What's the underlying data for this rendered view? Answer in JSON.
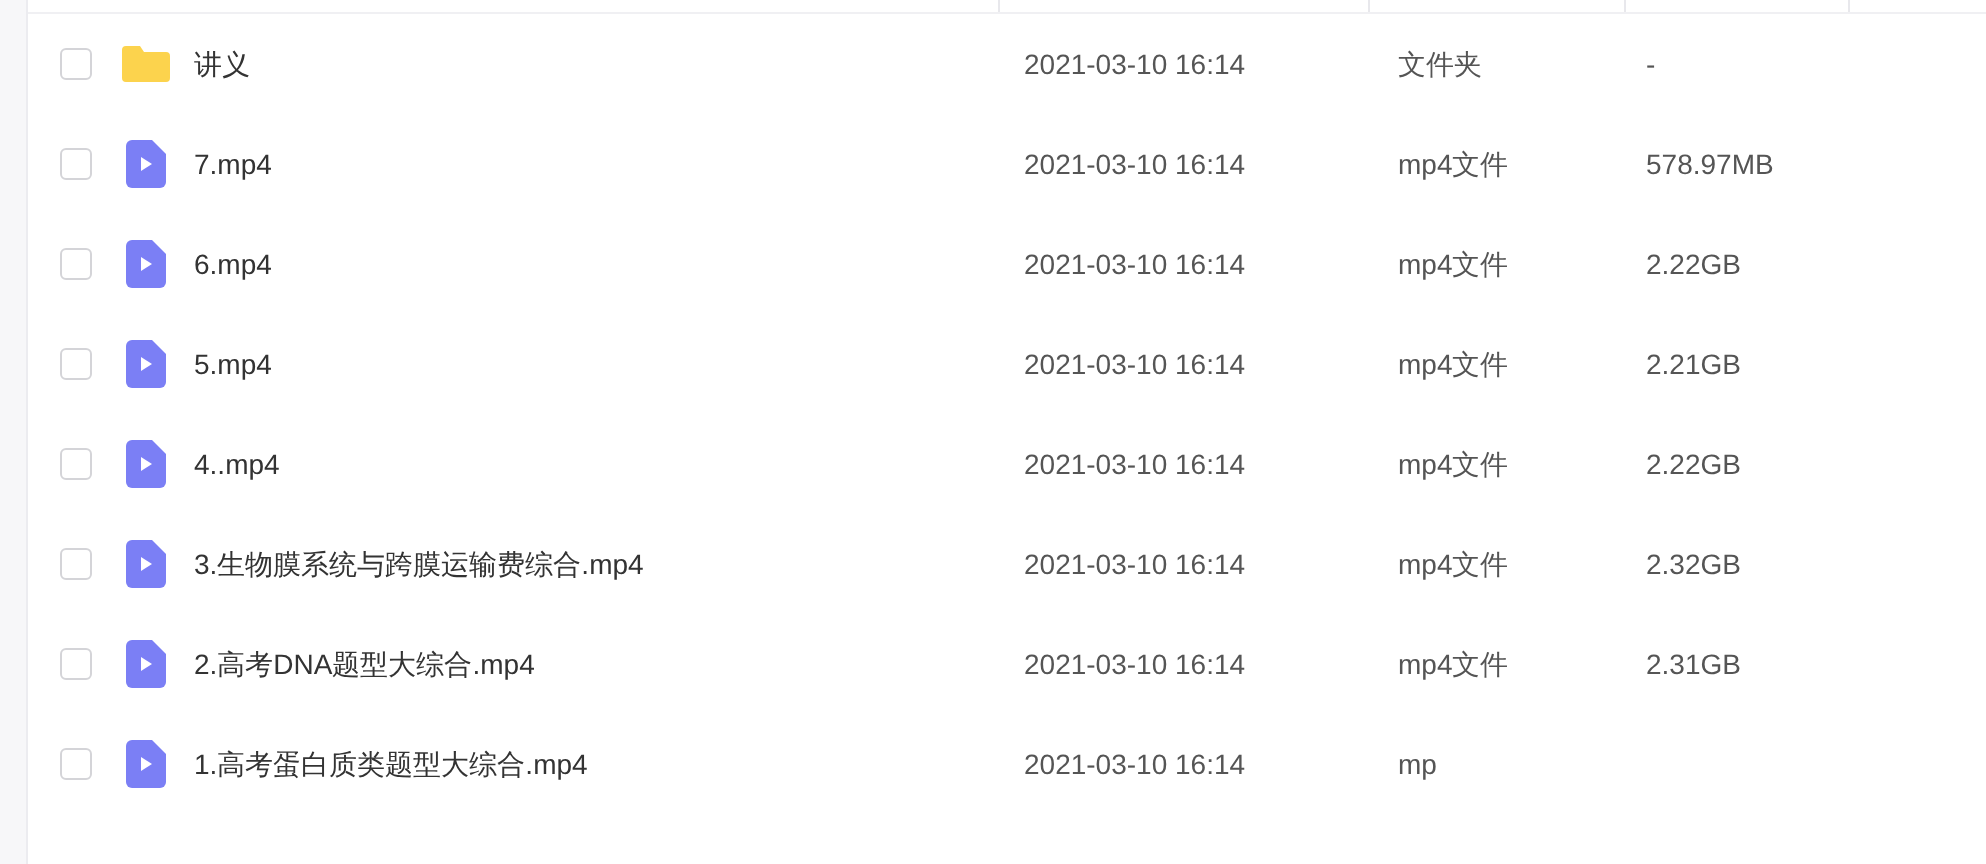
{
  "files": [
    {
      "kind": "folder",
      "name": "讲义",
      "modified": "2021-03-10 16:14",
      "type": "文件夹",
      "size": "-",
      "checked": false
    },
    {
      "kind": "video",
      "name": "7.mp4",
      "modified": "2021-03-10 16:14",
      "type": "mp4文件",
      "size": "578.97MB",
      "checked": false
    },
    {
      "kind": "video",
      "name": "6.mp4",
      "modified": "2021-03-10 16:14",
      "type": "mp4文件",
      "size": "2.22GB",
      "checked": false
    },
    {
      "kind": "video",
      "name": "5.mp4",
      "modified": "2021-03-10 16:14",
      "type": "mp4文件",
      "size": "2.21GB",
      "checked": false
    },
    {
      "kind": "video",
      "name": "4..mp4",
      "modified": "2021-03-10 16:14",
      "type": "mp4文件",
      "size": "2.22GB",
      "checked": false
    },
    {
      "kind": "video",
      "name": "3.生物膜系统与跨膜运输费综合.mp4",
      "modified": "2021-03-10 16:14",
      "type": "mp4文件",
      "size": "2.32GB",
      "checked": false
    },
    {
      "kind": "video",
      "name": "2.高考DNA题型大综合.mp4",
      "modified": "2021-03-10 16:14",
      "type": "mp4文件",
      "size": "2.31GB",
      "checked": false
    },
    {
      "kind": "video",
      "name": "1.高考蛋白质类题型大综合.mp4",
      "modified": "2021-03-10 16:14",
      "type": "mp",
      "checked": false
    }
  ]
}
